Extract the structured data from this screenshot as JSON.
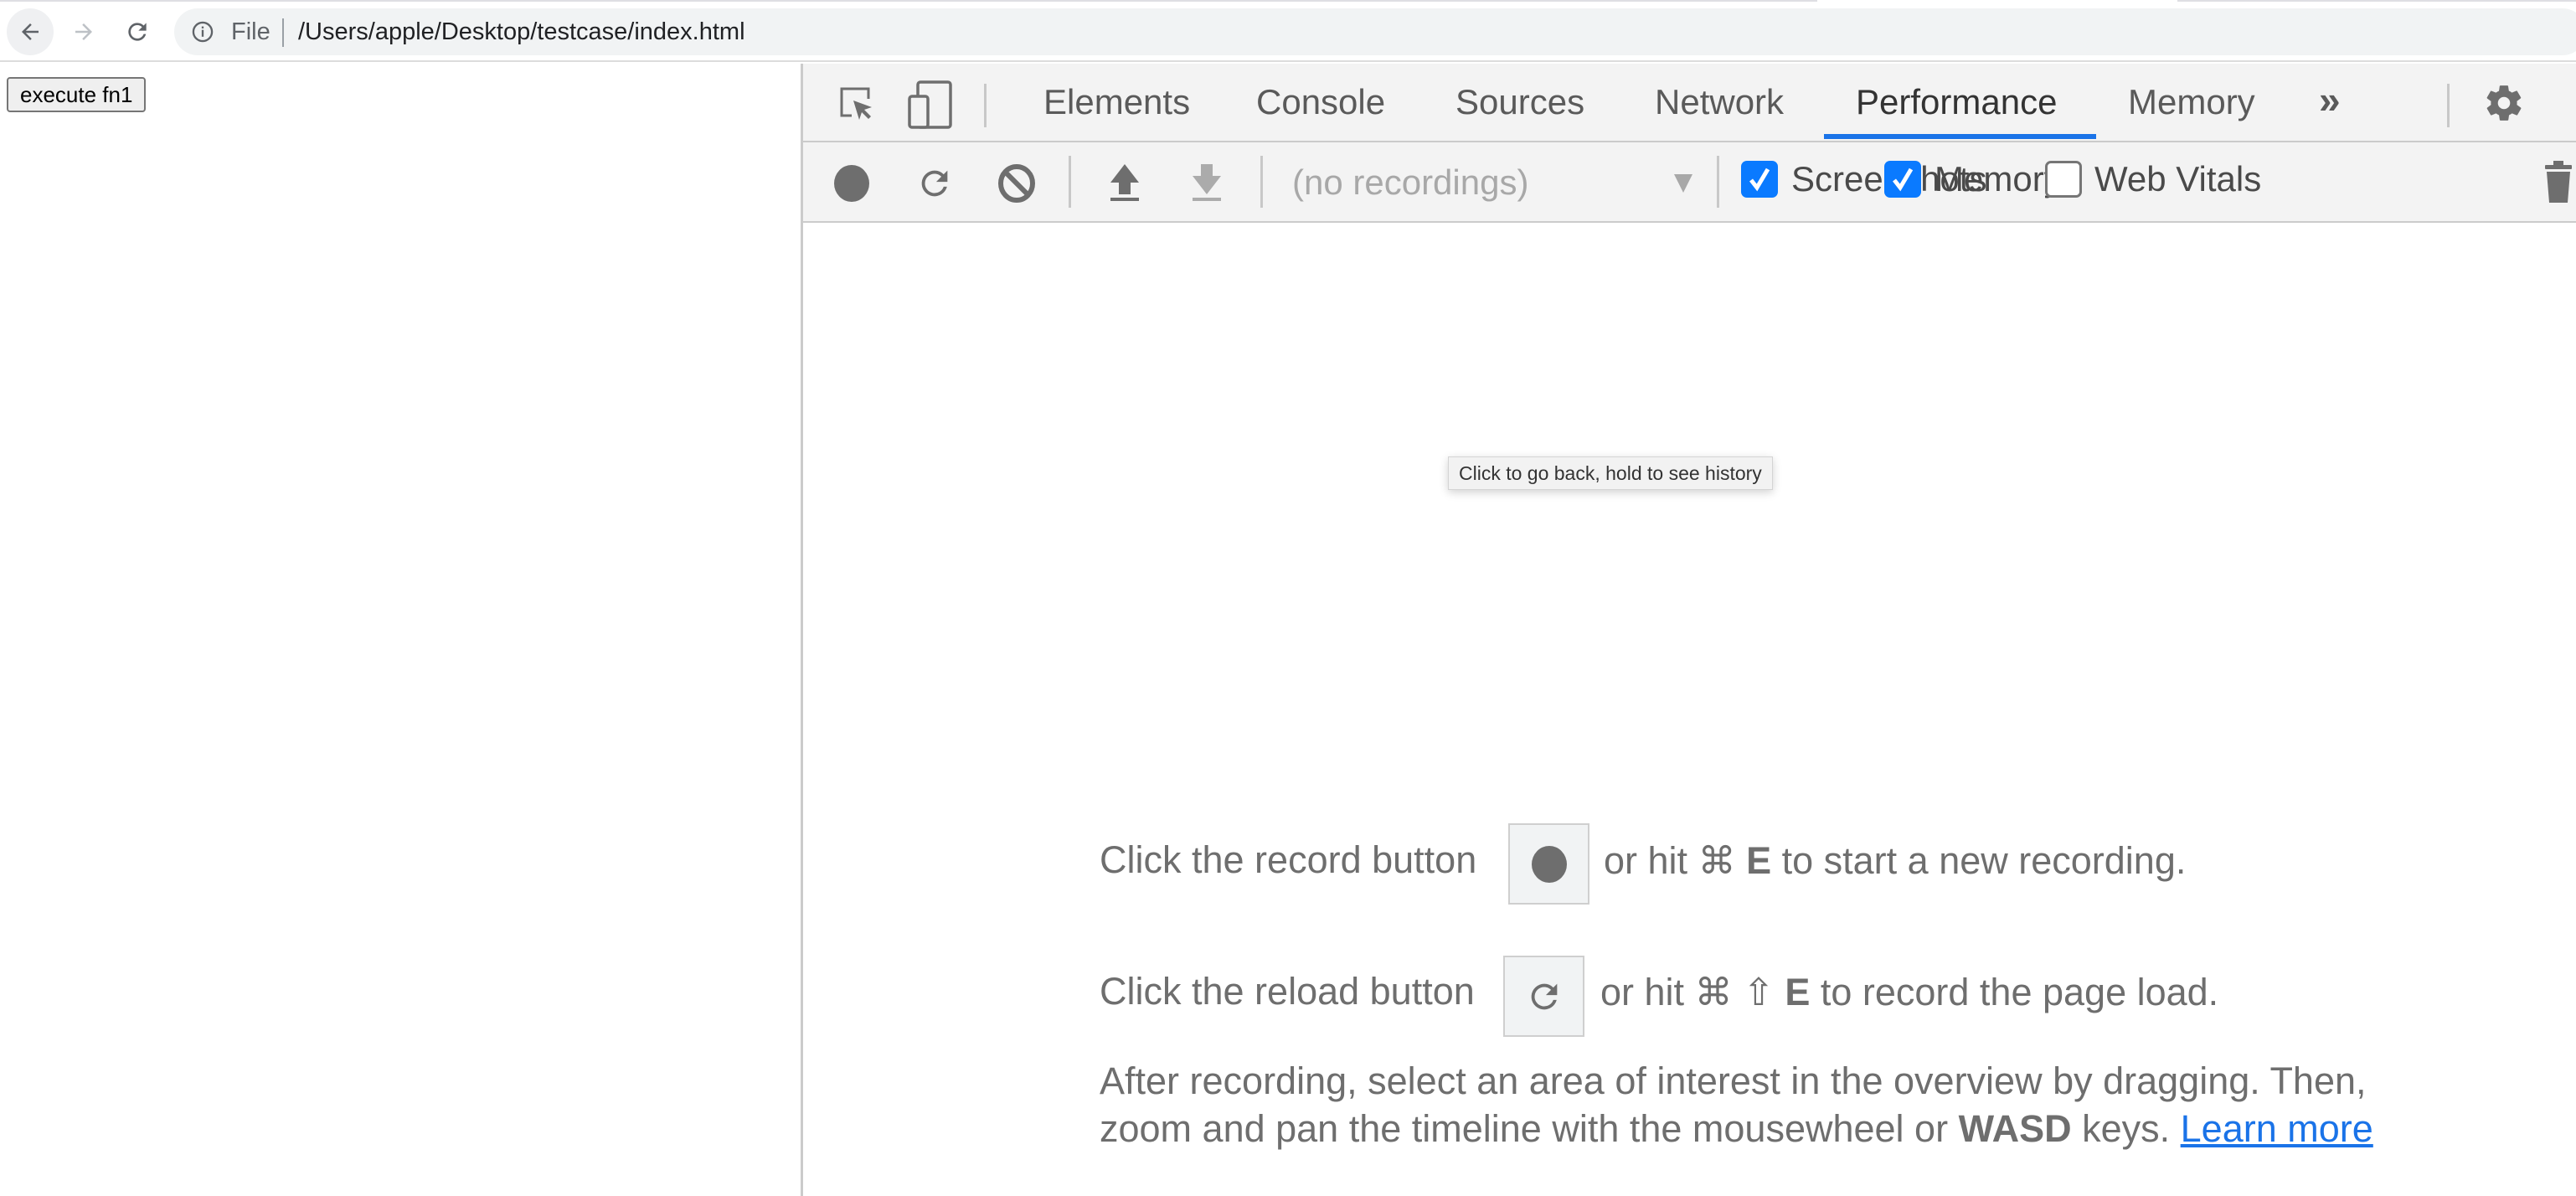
{
  "browser": {
    "omnibox": {
      "scheme_label": "File",
      "url": "/Users/apple/Desktop/testcase/index.html"
    },
    "icons": {
      "back": "arrow-left-icon",
      "forward": "arrow-right-icon",
      "reload": "reload-icon",
      "info": "info-icon",
      "bookmark": "star-icon"
    }
  },
  "page": {
    "execute_button_label": "execute fn1"
  },
  "devtools": {
    "tabs": [
      {
        "label": "Elements",
        "active": false
      },
      {
        "label": "Console",
        "active": false
      },
      {
        "label": "Sources",
        "active": false
      },
      {
        "label": "Network",
        "active": false
      },
      {
        "label": "Performance",
        "active": true
      },
      {
        "label": "Memory",
        "active": false
      }
    ],
    "more_tabs_label": "»",
    "accent_color": "#1a73e8",
    "toolbar": {
      "recordings_select": "(no recordings)",
      "checkboxes": [
        {
          "label": "Screenshots",
          "checked": true
        },
        {
          "label": "Memory",
          "checked": true
        },
        {
          "label": "Web Vitals",
          "checked": false
        }
      ]
    },
    "tooltip": "Click to go back, hold to see history",
    "landing": {
      "record_line": {
        "prefix": "Click the record button",
        "middle": "or hit",
        "cmd_symbol": "⌘",
        "key": "E",
        "suffix": "to start a new recording."
      },
      "reload_line": {
        "prefix": "Click the reload button",
        "middle": "or hit",
        "cmd_symbol": "⌘",
        "shift_symbol": "⇧",
        "key": "E",
        "suffix": "to record the page load."
      },
      "help": {
        "line1": "After recording, select an area of interest in the overview by dragging. Then,",
        "line2_prefix": "zoom and pan the timeline with the mousewheel or",
        "line2_bold": "WASD",
        "line2_suffix": "keys.",
        "link": "Learn more"
      }
    }
  }
}
